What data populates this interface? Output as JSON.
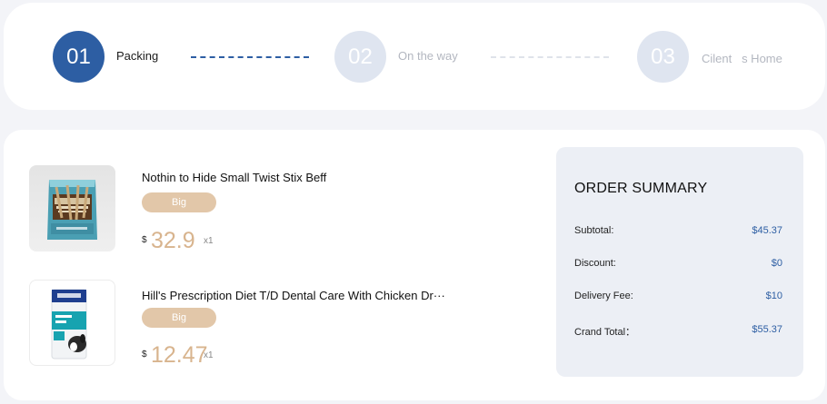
{
  "steps": [
    {
      "number": "01",
      "label": "Packing"
    },
    {
      "number": "02",
      "label": "On the way"
    },
    {
      "number": "03",
      "label": "Cilent   s Home"
    }
  ],
  "products": [
    {
      "name": "Nothin to Hide Small Twist Stix Beff",
      "tag": "Big",
      "currency": "$",
      "price": "32.9",
      "qty": "x1",
      "image": "beef-twist-stix-bag"
    },
    {
      "name": "Hill's Prescription Diet T/D Dental Care With Chicken Dr···",
      "tag": "Big",
      "currency": "$",
      "price": "12.47",
      "qty": "x1",
      "image": "dog-food-bag"
    }
  ],
  "summary": {
    "title": "ORDER SUMMARY",
    "rows": [
      {
        "label": "Subtotal:",
        "value": "$45.37"
      },
      {
        "label": "Discount:",
        "value": "$0"
      },
      {
        "label": "Delivery Fee:",
        "value": "$10"
      },
      {
        "label": "Crand Total：",
        "value": "$55.37"
      }
    ]
  },
  "colors": {
    "accent": "#2d5ea3",
    "price": "#d8b48e",
    "tag": "#e2c7a9",
    "summary_bg": "#eceff5"
  }
}
